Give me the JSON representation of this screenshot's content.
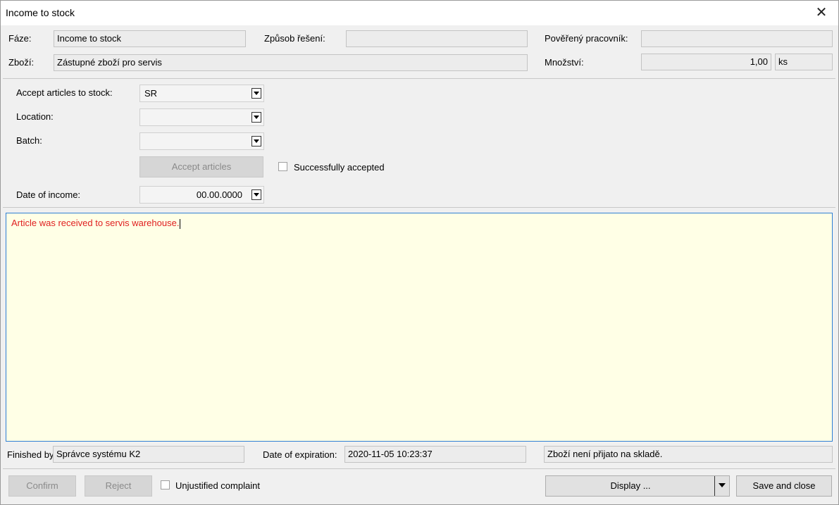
{
  "window": {
    "title": "Income to stock"
  },
  "header": {
    "faze_label": "Fáze:",
    "faze_value": "Income to stock",
    "zpusob_label": "Způsob řešení:",
    "zpusob_value": "",
    "povereny_label": "Pověřený pracovník:",
    "povereny_value": "",
    "zbozi_label": "Zboží:",
    "zbozi_value": "Zástupné zboží pro servis",
    "mnozstvi_label": "Množství:",
    "mnozstvi_value": "1,00",
    "unit_value": "ks"
  },
  "form": {
    "accept_label": "Accept articles to stock:",
    "accept_value": "SR",
    "location_label": "Location:",
    "location_value": "",
    "batch_label": "Batch:",
    "batch_value": "",
    "accept_button": "Accept articles",
    "success_label": "Successfully accepted",
    "date_label": "Date of income:",
    "date_value": "00.00.0000"
  },
  "note": {
    "text": "Article was received to servis warehouse."
  },
  "footer": {
    "finished_label": "Finished by",
    "finished_value": "Správce systému K2",
    "expiration_label": "Date of expiration:",
    "expiration_value": "2020-11-05 10:23:37",
    "status_value": "Zboží není přijato na skladě."
  },
  "buttons": {
    "confirm": "Confirm",
    "reject": "Reject",
    "unjustified": "Unjustified complaint",
    "display": "Display ...",
    "save_close": "Save and close"
  }
}
